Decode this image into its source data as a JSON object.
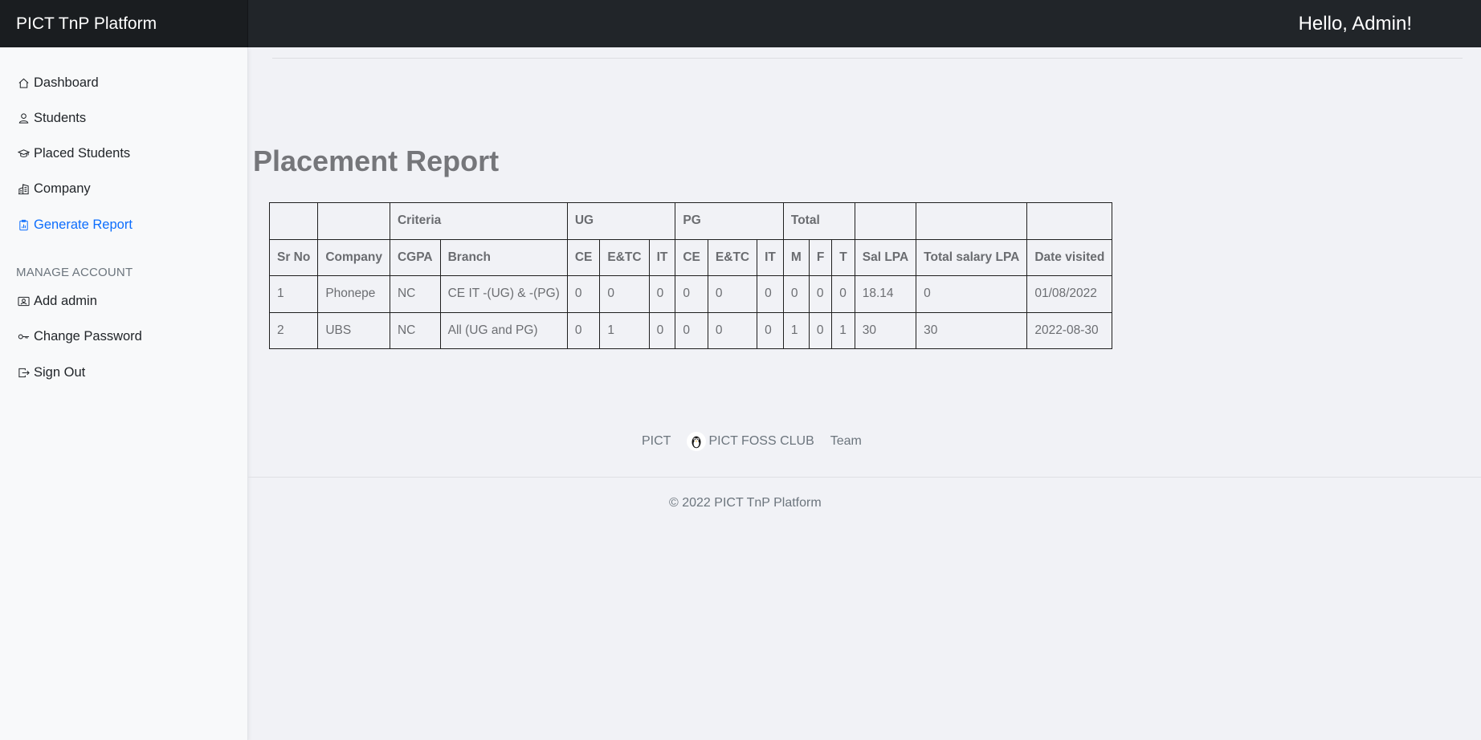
{
  "app": {
    "brand": "PICT TnP Platform",
    "greeting": "Hello, Admin!"
  },
  "sidebar": {
    "items": [
      {
        "label": "Dashboard",
        "icon": "house-icon"
      },
      {
        "label": "Students",
        "icon": "person-icon"
      },
      {
        "label": "Placed Students",
        "icon": "mortarboard-icon"
      },
      {
        "label": "Company",
        "icon": "building-icon"
      },
      {
        "label": "Generate Report",
        "icon": "report-icon",
        "active": true
      }
    ],
    "section_label": "MANAGE ACCOUNT",
    "account_items": [
      {
        "label": "Add admin",
        "icon": "person-badge-icon"
      },
      {
        "label": "Change Password",
        "icon": "key-icon"
      },
      {
        "label": "Sign Out",
        "icon": "box-arrow-right-icon"
      }
    ]
  },
  "main": {
    "title": "Placement Report",
    "table": {
      "group_headers": {
        "criteria": "Criteria",
        "ug": "UG",
        "pg": "PG",
        "total": "Total"
      },
      "columns": [
        "Sr No",
        "Company",
        "CGPA",
        "Branch",
        "CE",
        "E&TC",
        "IT",
        "CE",
        "E&TC",
        "IT",
        "M",
        "F",
        "T",
        "Sal LPA",
        "Total salary LPA",
        "Date visited"
      ],
      "rows": [
        [
          "1",
          "Phonepe",
          "NC",
          "CE IT -(UG) & -(PG)",
          "0",
          "0",
          "0",
          "0",
          "0",
          "0",
          "0",
          "0",
          "0",
          "18.14",
          "0",
          "01/08/2022"
        ],
        [
          "2",
          "UBS",
          "NC",
          "All (UG and PG)",
          "0",
          "1",
          "0",
          "0",
          "0",
          "0",
          "1",
          "0",
          "1",
          "30",
          "30",
          "2022-08-30"
        ]
      ]
    }
  },
  "footer": {
    "links": [
      "PICT",
      "PICT FOSS CLUB",
      "Team"
    ],
    "copyright": "© 2022 PICT TnP Platform"
  },
  "colors": {
    "topbar": "#212529",
    "active_link": "#0d6efd",
    "background": "#f1f2f6"
  }
}
